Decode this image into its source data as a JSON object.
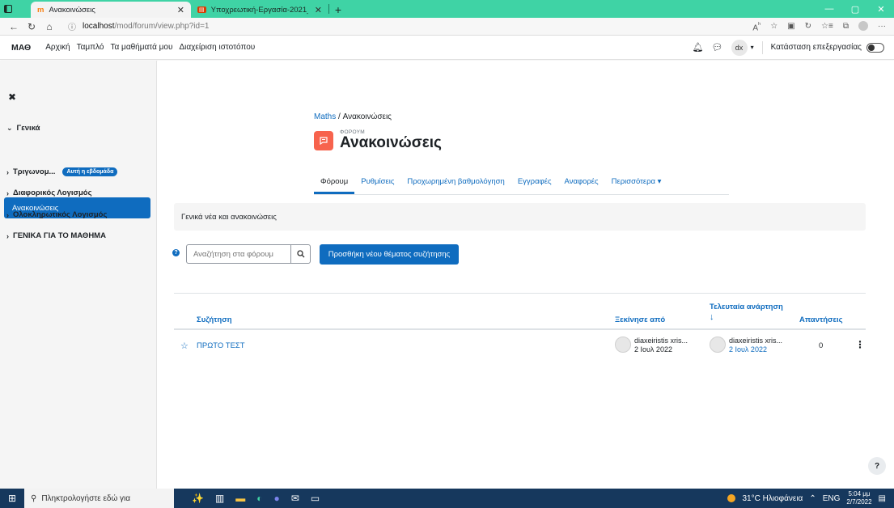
{
  "browser": {
    "tabs": [
      {
        "label": "Ανακοινώσεις",
        "active": true
      },
      {
        "label": "Υποχρεωτική-Εργασία-2021_20",
        "active": false
      }
    ],
    "url_host": "localhost",
    "url_path": "/mod/forum/view.php?id=1"
  },
  "topnav": {
    "brand": "ΜΑΘ",
    "items": [
      "Αρχική",
      "Ταμπλό",
      "Τα μαθήματά μου",
      "Διαχείριση ιστοτόπου"
    ],
    "user_initials": "dx",
    "edit_mode_label": "Κατάσταση επεξεργασίας"
  },
  "drawer": {
    "section_general": "Γενικά",
    "active_item": "Ανακοινώσεις",
    "sections": [
      "Τριγωνομ...",
      "Διαφορικός Λογισμός",
      "Ολοκληρωτικός Λογισμός",
      "ΓΕΝΙΚΑ ΓΙΑ ΤΟ ΜΑΘΗΜΑ"
    ],
    "week_badge": "Αυτή η εβδομάδα"
  },
  "page": {
    "breadcrumb_course": "Maths",
    "breadcrumb_sep": "/",
    "breadcrumb_current": "Ανακοινώσεις",
    "eyebrow": "ΦΟΡΟΥΜ",
    "title": "Ανακοινώσεις",
    "tabs": [
      "Φόρουμ",
      "Ρυθμίσεις",
      "Προχωρημένη βαθμολόγηση",
      "Εγγραφές",
      "Αναφορές",
      "Περισσότερα ▾"
    ],
    "intro": "Γενικά νέα και ανακοινώσεις",
    "search_placeholder": "Αναζήτηση στα φόρουμ",
    "add_button": "Προσθήκη νέου θέματος συζήτησης"
  },
  "table": {
    "headers": {
      "discussion": "Συζήτηση",
      "started_by": "Ξεκίνησε από",
      "last_post": "Τελευταία ανάρτηση",
      "last_post_arrow": "↓",
      "replies": "Απαντήσεις"
    },
    "rows": [
      {
        "title": "ΠΡΩΤΟ ΤΕΣΤ",
        "starter_name": "diaxeiristis xris...",
        "starter_date": "2 Ιουλ 2022",
        "last_name": "diaxeiristis xris...",
        "last_date": "2 Ιουλ 2022",
        "replies": "0"
      }
    ]
  },
  "taskbar": {
    "search_placeholder": "Πληκτρολογήστε εδώ για",
    "weather": "31°C Ηλιοφάνεια",
    "lang": "ENG",
    "time": "5:04 μμ",
    "date": "2/7/2022"
  }
}
